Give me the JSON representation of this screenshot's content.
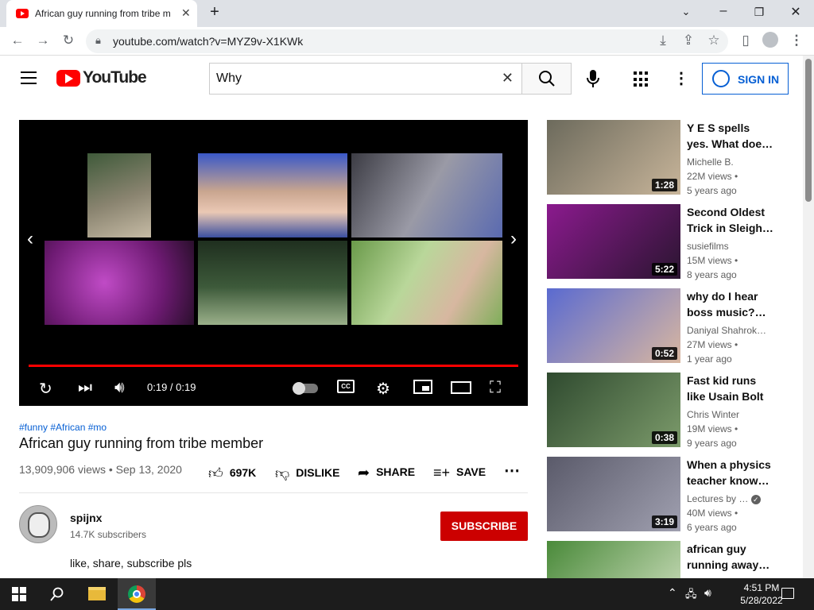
{
  "browser": {
    "tab_title": "African guy running from tribe m",
    "url": "youtube.com/watch?v=MYZ9v-X1KWk"
  },
  "header": {
    "logo_text": "YouTube",
    "search_query": "Why",
    "sign_in_label": "SIGN IN"
  },
  "player": {
    "time": "0:19 / 0:19",
    "progress_fraction": 1.0
  },
  "video": {
    "tags": "#funny #African #mo",
    "title": "African guy running from tribe member",
    "meta": "13,909,906 views • Sep 13, 2020",
    "like_label": "697K",
    "dislike_label": "DISLIKE",
    "share_label": "SHARE",
    "save_label": "SAVE"
  },
  "channel": {
    "name": "spijnx",
    "subscribers": "14.7K subscribers",
    "subscribe_label": "SUBSCRIBE",
    "description": "like, share, subscribe pls"
  },
  "related": [
    {
      "title1": "Y E S spells",
      "title2": "yes. What doe…",
      "channel": "Michelle B.",
      "views": "22M views •",
      "age": "5 years ago",
      "duration": "1:28",
      "colors": [
        "#6c6a5c",
        "#c8b59a"
      ]
    },
    {
      "title1": "Second Oldest",
      "title2": "Trick in Sleigh…",
      "channel": "susiefilms",
      "views": "15M views •",
      "age": "8 years ago",
      "duration": "5:22",
      "colors": [
        "#8b1a8e",
        "#2a1530"
      ]
    },
    {
      "title1": "why do I hear",
      "title2": "boss music?…",
      "channel": "Daniyal Shahrok…",
      "views": "27M views •",
      "age": "1 year ago",
      "duration": "0:52",
      "colors": [
        "#5a6ad0",
        "#d9b7a0"
      ]
    },
    {
      "title1": "Fast kid runs",
      "title2": "like Usain Bolt",
      "channel": "Chris Winter",
      "views": "19M views •",
      "age": "9 years ago",
      "duration": "0:38",
      "colors": [
        "#2f4a2f",
        "#7c9b6b"
      ]
    },
    {
      "title1": "When a physics",
      "title2": "teacher know…",
      "channel": "Lectures by …",
      "views": "40M views •",
      "age": "6 years ago",
      "duration": "3:19",
      "colors": [
        "#5a5a6a",
        "#a0a0b0"
      ]
    },
    {
      "title1": "african guy",
      "title2": "running away…",
      "channel": "",
      "views": "",
      "age": "",
      "duration": "",
      "colors": [
        "#4a8a3a",
        "#d0e0c0"
      ]
    }
  ],
  "taskbar": {
    "time": "4:51 PM",
    "date": "5/28/2022"
  },
  "icons": {
    "accent": "#065fd4",
    "brand": "#ff0000"
  }
}
